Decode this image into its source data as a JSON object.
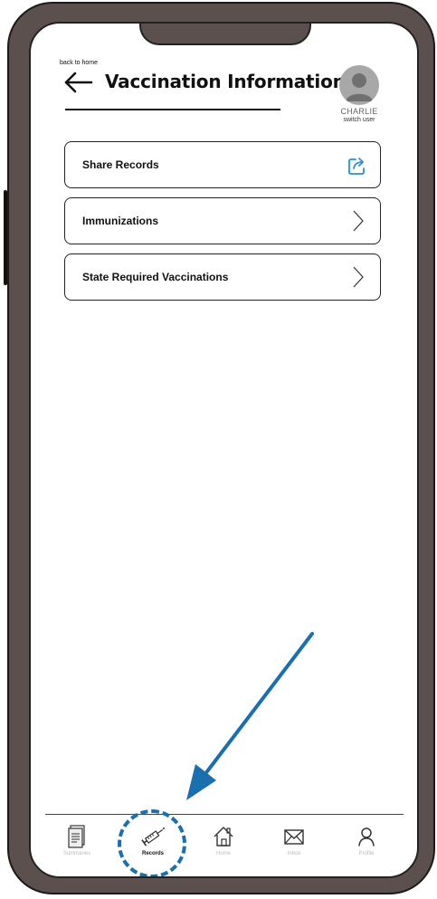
{
  "header": {
    "back_label": "back to home",
    "title": "Vaccination Information",
    "user_name": "CHARLIE",
    "switch_user": "switch user"
  },
  "menu": {
    "items": [
      {
        "label": "Share Records",
        "icon": "share-icon"
      },
      {
        "label": "Immunizations",
        "icon": "chevron-right-icon"
      },
      {
        "label": "State Required Vaccinations",
        "icon": "chevron-right-icon"
      }
    ]
  },
  "nav": {
    "items": [
      {
        "label": "Summaries",
        "icon": "document-icon",
        "active": false
      },
      {
        "label": "Records",
        "icon": "syringe-icon",
        "active": true
      },
      {
        "label": "Home",
        "icon": "home-icon",
        "active": false
      },
      {
        "label": "Inbox",
        "icon": "envelope-icon",
        "active": false
      },
      {
        "label": "Profile",
        "icon": "person-icon",
        "active": false
      }
    ]
  },
  "colors": {
    "accent": "#1a6fae",
    "frame": "#5b504d",
    "share_icon": "#2a8fd6"
  }
}
